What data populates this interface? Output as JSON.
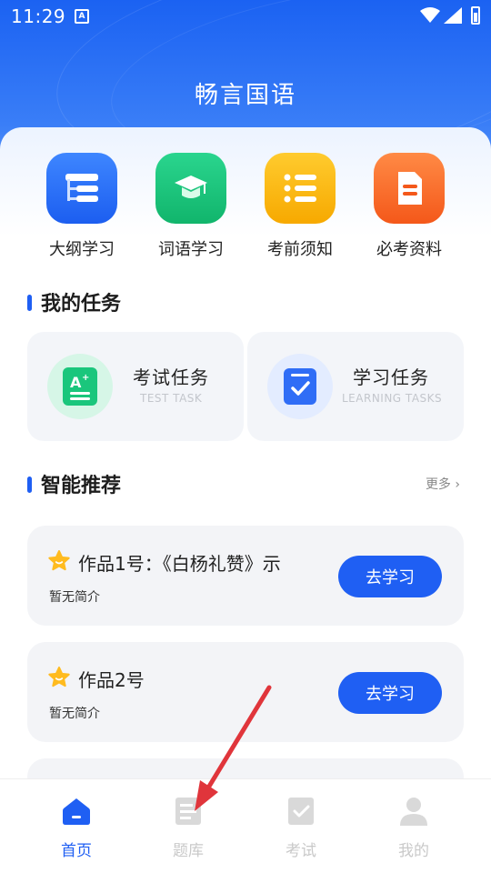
{
  "status_bar": {
    "time": "11:29",
    "notification_icon": "a-icon"
  },
  "app": {
    "title": "畅言国语"
  },
  "quick_menu": [
    {
      "label": "大纲学习",
      "icon": "outline-icon",
      "color": "#1c5ef0"
    },
    {
      "label": "词语学习",
      "icon": "graduation-cap-icon",
      "color": "#11b56c"
    },
    {
      "label": "考前须知",
      "icon": "list-icon",
      "color": "#f7a900"
    },
    {
      "label": "必考资料",
      "icon": "document-icon",
      "color": "#f4581a"
    }
  ],
  "tasks_section": {
    "title": "我的任务",
    "items": [
      {
        "name": "考试任务",
        "subtitle": "TEST TASK"
      },
      {
        "name": "学习任务",
        "subtitle": "LEARNING TASKS"
      }
    ]
  },
  "recommend_section": {
    "title": "智能推荐",
    "more": "更多",
    "cards": [
      {
        "title": "作品1号：《白杨礼赞》示",
        "desc": "暂无简介",
        "button": "去学习"
      },
      {
        "title": "作品2号",
        "desc": "暂无简介",
        "button": "去学习"
      }
    ]
  },
  "tab_bar": {
    "items": [
      {
        "label": "首页",
        "icon": "home-icon",
        "active": true
      },
      {
        "label": "题库",
        "icon": "question-bank-icon",
        "active": false
      },
      {
        "label": "考试",
        "icon": "exam-icon",
        "active": false
      },
      {
        "label": "我的",
        "icon": "profile-icon",
        "active": false
      }
    ]
  },
  "colors": {
    "accent": "#1f5ff3",
    "annotation_arrow": "#e0353b"
  }
}
